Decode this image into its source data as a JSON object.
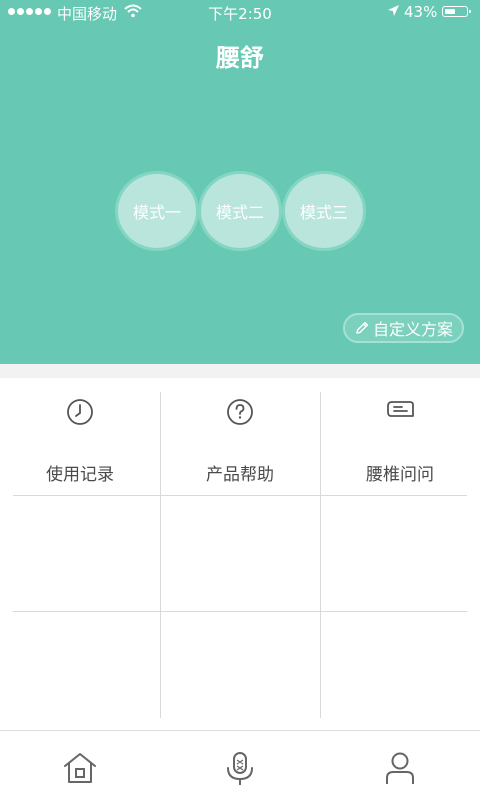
{
  "status_bar": {
    "carrier": "中国移动",
    "time": "下午2:50",
    "battery": "43%"
  },
  "header": {
    "title": "腰舒"
  },
  "modes": [
    {
      "label": "模式一"
    },
    {
      "label": "模式二"
    },
    {
      "label": "模式三"
    }
  ],
  "custom_plan": {
    "label": "自定义方案",
    "icon": "pencil-icon"
  },
  "grid": {
    "items": [
      {
        "label": "使用记录",
        "icon": "clock-icon"
      },
      {
        "label": "产品帮助",
        "icon": "help-icon"
      },
      {
        "label": "腰椎问问",
        "icon": "chat-icon"
      }
    ]
  },
  "tab_bar": {
    "tabs": [
      {
        "icon": "home-icon"
      },
      {
        "icon": "microphone-icon"
      },
      {
        "icon": "user-icon"
      }
    ]
  },
  "colors": {
    "primary": "#67C9B3",
    "mode_circle": "#B9E5DC",
    "icon_gray": "#555555"
  }
}
